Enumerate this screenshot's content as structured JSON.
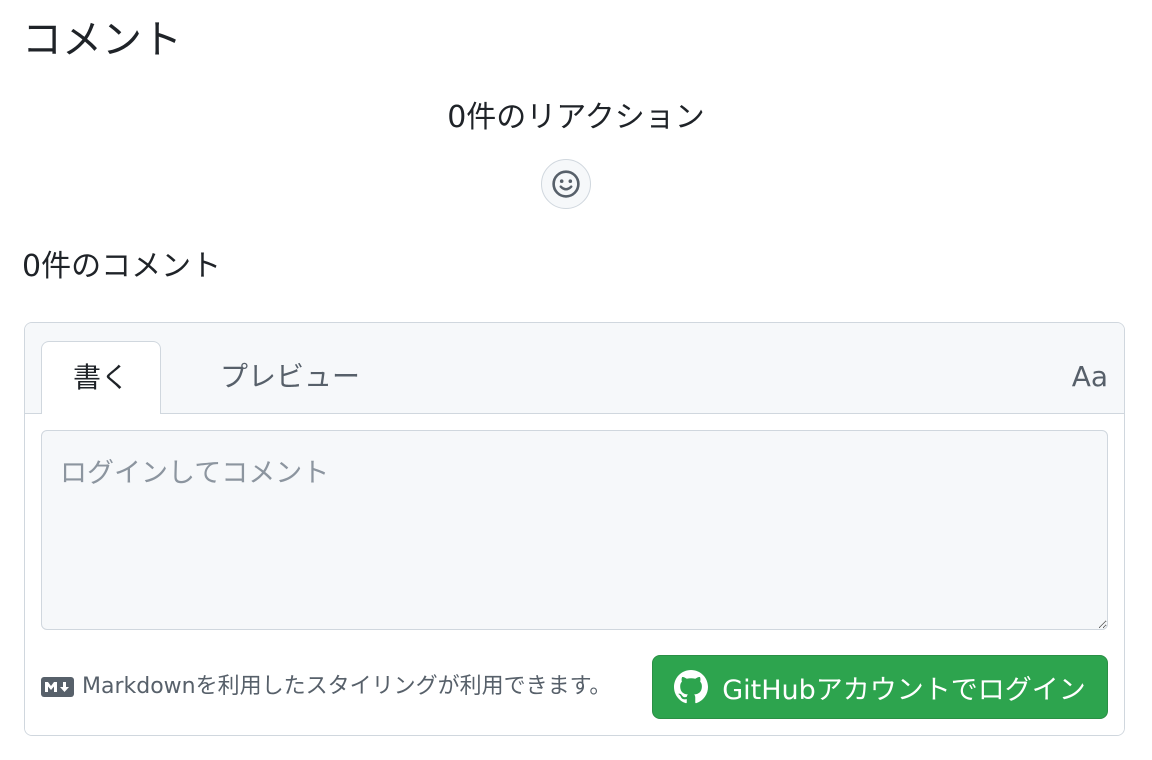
{
  "section": {
    "title": "コメント"
  },
  "reactions": {
    "heading": "0件のリアクション",
    "add_icon": "smiley-icon"
  },
  "comments": {
    "heading": "0件のコメント"
  },
  "editor": {
    "tabs": [
      {
        "label": "書く",
        "active": true
      },
      {
        "label": "プレビュー",
        "active": false
      }
    ],
    "font_toggle": "Aa",
    "placeholder": "ログインしてコメント",
    "markdown_hint": "Markdownを利用したスタイリングが利用できます。",
    "markdown_icon": "markdown-icon",
    "login_button": "GitHubアカウントでログイン",
    "login_icon": "github-icon"
  },
  "colors": {
    "accent_green": "#2da44e",
    "border": "#d0d7de",
    "muted_bg": "#f6f8fa",
    "muted_text": "#57606a"
  }
}
